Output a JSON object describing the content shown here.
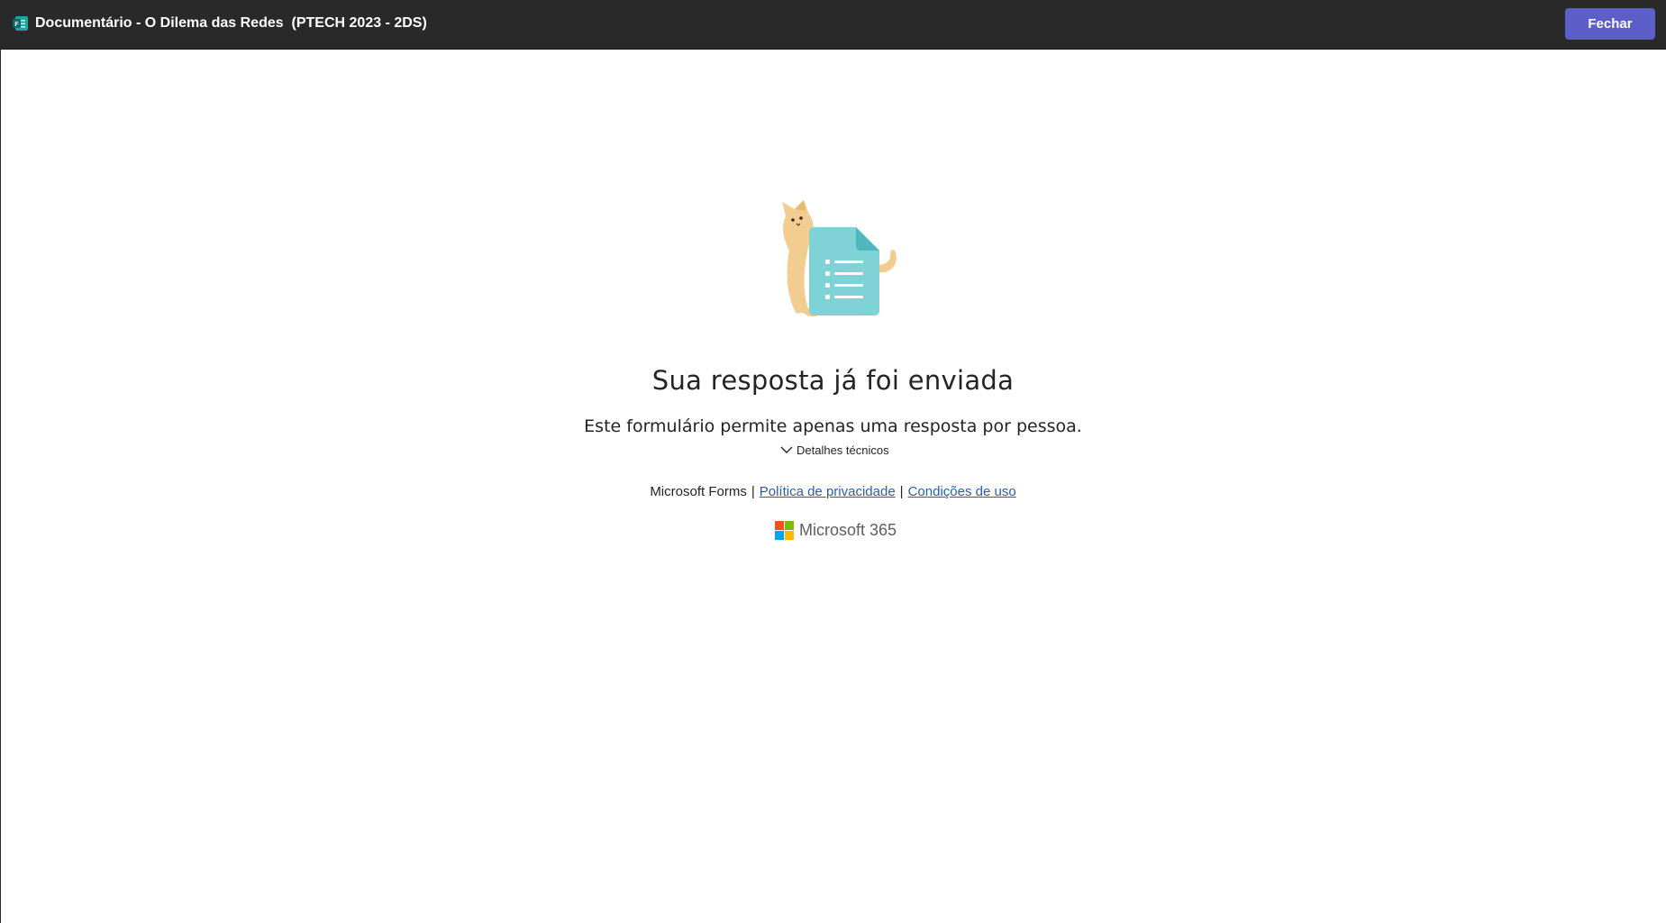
{
  "titlebar": {
    "app_icon": "microsoft-forms-icon",
    "title": "Documentário - O Dilema das Redes  (PTECH 2023 - 2DS)",
    "close_label": "Fechar",
    "close_button_color": "#5b5fc7",
    "background": "#292929"
  },
  "main": {
    "illustration": "cat-with-form-illustration",
    "heading": "Sua resposta já foi enviada",
    "message": "Este formulário permite apenas uma resposta por pessoa.",
    "details_toggle": {
      "icon": "chevron-down-icon",
      "label": "Detalhes técnicos"
    }
  },
  "footer": {
    "brand": "Microsoft Forms",
    "separator": "|",
    "privacy_link": "Política de privacidade",
    "terms_link": "Condições de uso",
    "link_color": "#2b5ea8",
    "m365_label": "Microsoft 365",
    "m365_logo_colors": [
      "#f25022",
      "#7fba00",
      "#00a4ef",
      "#ffb900"
    ]
  }
}
